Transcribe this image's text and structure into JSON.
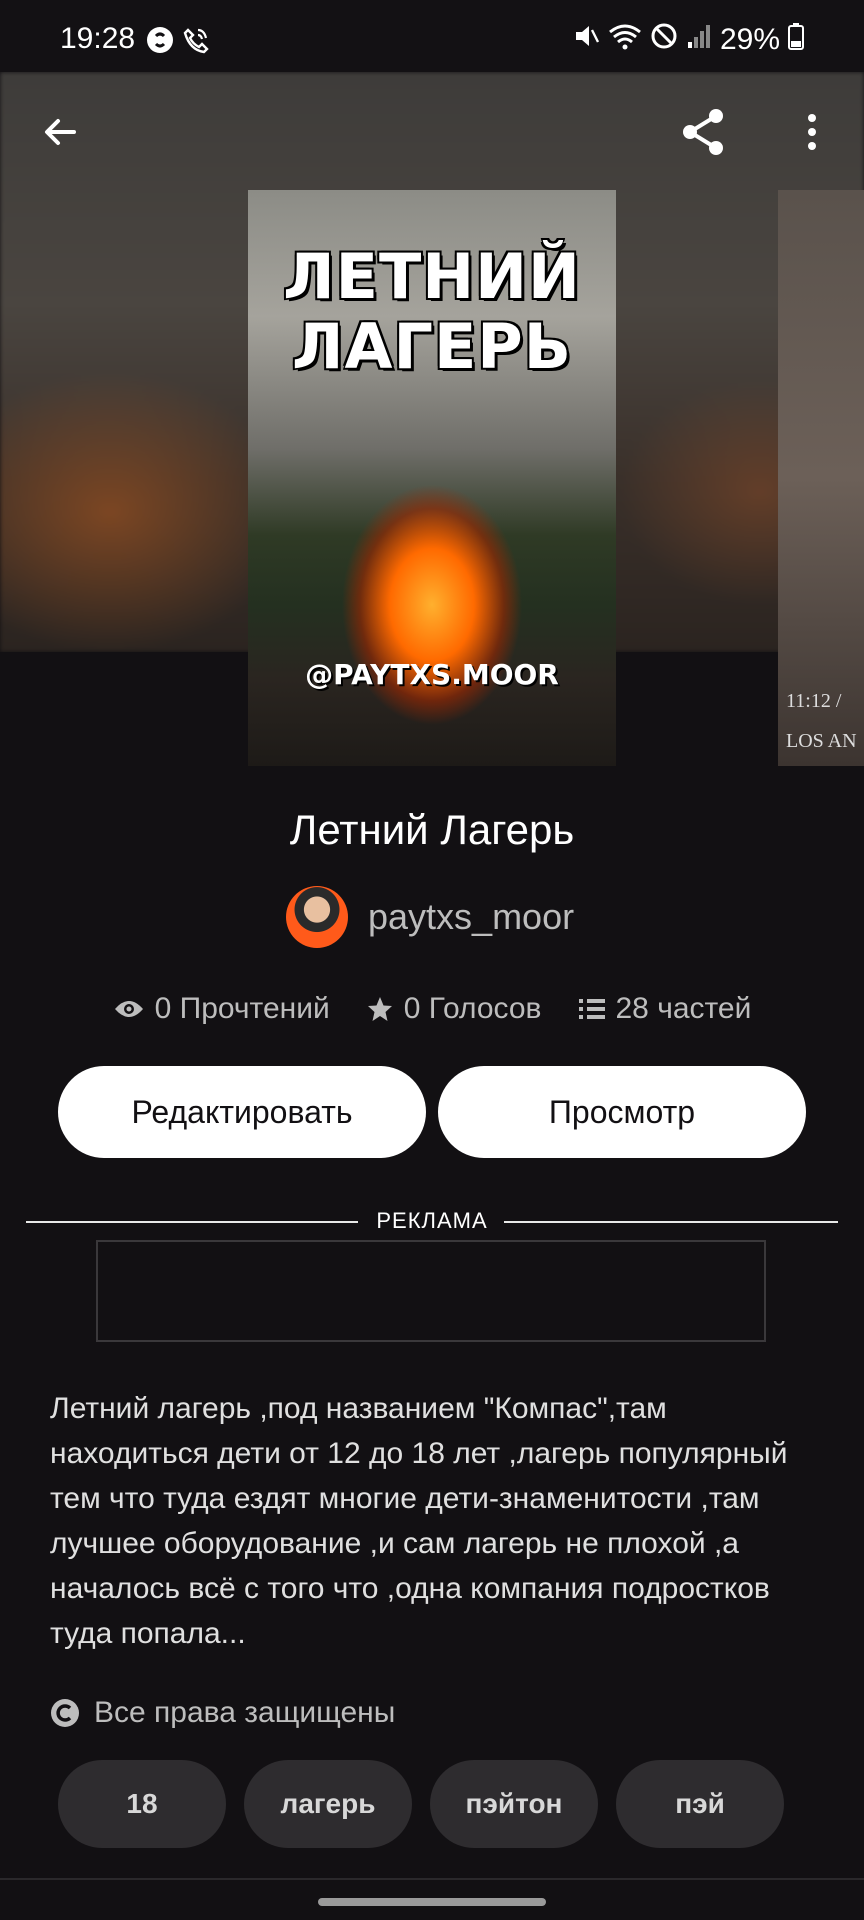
{
  "status_bar": {
    "time": "19:28",
    "battery": "29%",
    "icons_left": [
      "shazam-icon",
      "wifi-call-icon"
    ],
    "icons_right": [
      "mute-icon",
      "wifi-icon",
      "do-not-disturb-icon",
      "signal-icon",
      "battery-icon"
    ]
  },
  "toolbar": {
    "back_icon": "arrow-left-icon",
    "share_icon": "share-icon",
    "more_icon": "more-vertical-icon"
  },
  "cover": {
    "title_line1": "ЛЕТНИЙ",
    "title_line2": "ЛАГЕРЬ",
    "handle": "@PAYTXS.MOOR",
    "next_cover_text1": "11:12 /",
    "next_cover_text2": "LOS AN"
  },
  "story": {
    "title": "Летний Лагерь",
    "author": "paytxs_moor",
    "reads": "0 Прочтений",
    "votes": "0 Голосов",
    "parts": "28 частей"
  },
  "actions": {
    "edit_label": "Редактировать",
    "preview_label": "Просмотр"
  },
  "ad": {
    "label": "РЕКЛАМА"
  },
  "description": "Летний лагерь ,под названием \"Компас\",там находиться дети от 12 до 18 лет ,лагерь популярный тем что туда ездят многие дети-знаменитости ,там лучшее оборудование ,и сам лагерь не плохой ,а началось всё с того что ,одна компания подростков туда попала...",
  "copyright": "Все права защищены",
  "tags": [
    "18",
    "лагерь",
    "пэйтон",
    "пэй"
  ],
  "colors": {
    "background": "#121013",
    "button_bg": "#ffffff",
    "tag_bg": "#2e2c2f",
    "muted_text": "#bdbdbd"
  }
}
